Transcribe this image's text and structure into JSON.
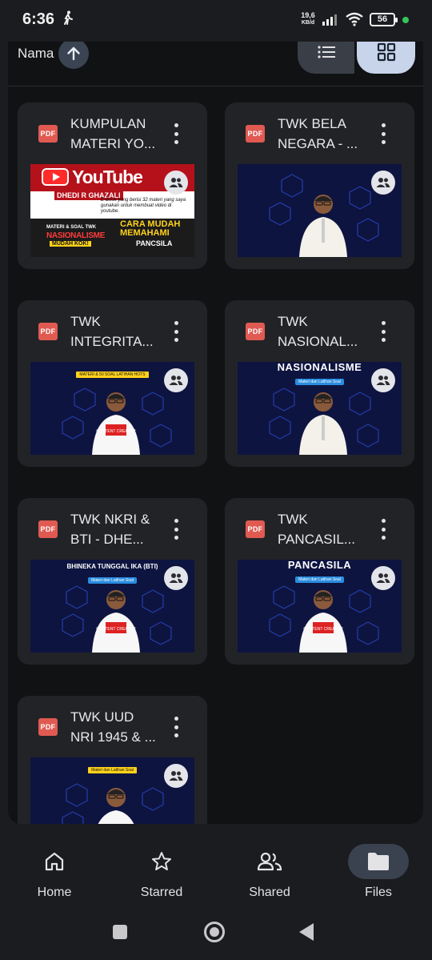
{
  "status_bar": {
    "time": "6:36",
    "speed_value": "19,6",
    "speed_unit": "KB/d",
    "battery": "56"
  },
  "sort": {
    "label": "Nama"
  },
  "files": [
    {
      "title": "KUMPULAN\nMATERI YO...",
      "type_label": "PDF",
      "thumbnail": "youtube-ebook-cover"
    },
    {
      "title": "TWK BELA\nNEGARA - ...",
      "type_label": "PDF",
      "thumbnail": "presenter-cover"
    },
    {
      "title": "TWK\nINTEGRITA...",
      "type_label": "PDF",
      "thumbnail": "presenter-cover"
    },
    {
      "title": "TWK\nNASIONAL...",
      "type_label": "PDF",
      "thumbnail": "presenter-cover"
    },
    {
      "title": "TWK NKRI &\nBTI - DHE...",
      "type_label": "PDF",
      "thumbnail": "presenter-cover"
    },
    {
      "title": "TWK\nPANCASIL...",
      "type_label": "PDF",
      "thumbnail": "presenter-cover"
    },
    {
      "title": "TWK UUD\nNRI 1945 & ...",
      "type_label": "PDF",
      "thumbnail": "presenter-cover"
    }
  ],
  "thumbnails": {
    "yt_word": "YouTube",
    "yt_author": "DHEDI R GHAZALI",
    "yt_desc": "E-Book yang berisi 32 materi yang saya gunakan untuk membuat video di youtube.",
    "yt_left1": "MATERI & SOAL TWK",
    "yt_left2": "NASIONALISME",
    "yt_left3": "MUDAH KOK!",
    "yt_right1": "CARA MUDAH MEMAHAMI",
    "yt_right2": "PANCSILA",
    "integritas_chip": "MATERI & 50 SOAL LATIHAN HOTS",
    "nasionalisme_big": "NASIONALISME",
    "nasionalisme_chip": "Materi dan Latihan Soal",
    "nkri_mid": "BHINEKA TUNGGAL IKA (BTI)",
    "nkri_chip": "Materi dan Latihan Soal",
    "pancasila_big": "PANCASILA",
    "pancasila_chip": "Materi dan Latihan Soal",
    "uud_chip": "Materi dan Latihan Soal",
    "shirt_text": "CONTENT CREATOR"
  },
  "bottom_nav": [
    {
      "label": "Home",
      "icon": "home-icon"
    },
    {
      "label": "Starred",
      "icon": "star-icon"
    },
    {
      "label": "Shared",
      "icon": "people-icon"
    },
    {
      "label": "Files",
      "icon": "folder-icon",
      "active": true
    }
  ],
  "colors": {
    "pdf_red": "#e05a52",
    "active_pill": "#3a4250",
    "grid_view_active": "#c7d4ea"
  }
}
